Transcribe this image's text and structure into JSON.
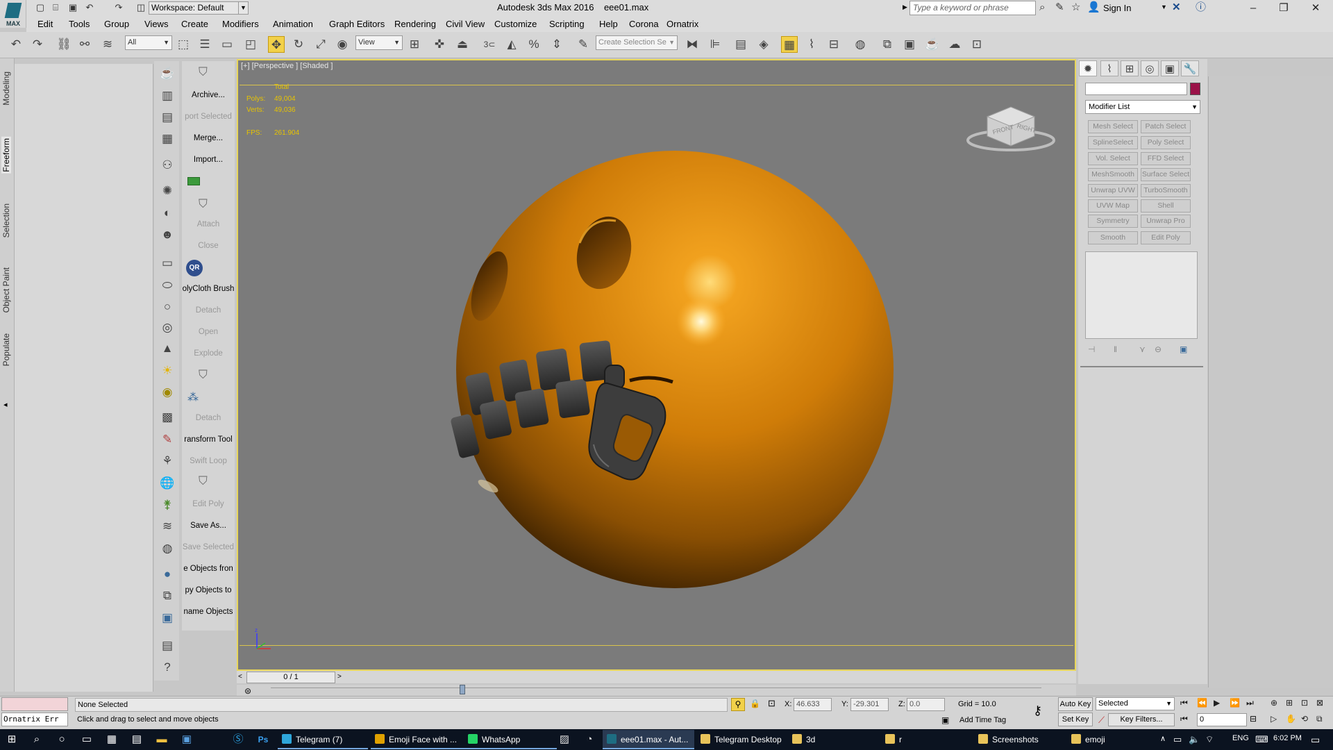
{
  "titlebar": {
    "workspace": "Workspace: Default",
    "app_title": "Autodesk 3ds Max 2016",
    "file_name": "eee01.max",
    "search_placeholder": "Type a keyword or phrase",
    "sign_in": "Sign In",
    "logo_text": "MAX"
  },
  "menu": [
    "Edit",
    "Tools",
    "Group",
    "Views",
    "Create",
    "Modifiers",
    "Animation",
    "Graph Editors",
    "Rendering",
    "Civil View",
    "Customize",
    "Scripting",
    "Help",
    "Corona",
    "Ornatrix"
  ],
  "toolbar": {
    "filter": "All",
    "ref_coord": "View",
    "selection_set_placeholder": "Create Selection Se",
    "snap_label": "3"
  },
  "ribbon_tabs": [
    "Modeling",
    "Freeform",
    "Selection",
    "Object Paint",
    "Populate"
  ],
  "command_panel": [
    {
      "label": "Archive...",
      "enabled": true
    },
    {
      "label": "port Selected",
      "enabled": false
    },
    {
      "label": "Merge...",
      "enabled": true
    },
    {
      "label": "Import...",
      "enabled": true
    },
    {
      "label": "Attach",
      "enabled": false
    },
    {
      "label": "Close",
      "enabled": false
    },
    {
      "label": "olyCloth Brush",
      "enabled": true
    },
    {
      "label": "Detach",
      "enabled": false
    },
    {
      "label": "Open",
      "enabled": false
    },
    {
      "label": "Explode",
      "enabled": false
    },
    {
      "label": "Detach",
      "enabled": false
    },
    {
      "label": "ransform Tool",
      "enabled": true
    },
    {
      "label": "Swift Loop",
      "enabled": false
    },
    {
      "label": "Edit Poly",
      "enabled": false
    },
    {
      "label": "Save As...",
      "enabled": true
    },
    {
      "label": "Save Selected",
      "enabled": false
    },
    {
      "label": "e Objects fron",
      "enabled": true
    },
    {
      "label": "py Objects to",
      "enabled": true
    },
    {
      "label": "name Objects",
      "enabled": true
    }
  ],
  "qr_badge": "QR",
  "viewport": {
    "label": "[+] [Perspective ] [Shaded ]",
    "stats": {
      "total_label": "Total",
      "polys_label": "Polys:",
      "polys": "49,004",
      "verts_label": "Verts:",
      "verts": "49,036",
      "fps_label": "FPS:",
      "fps": "261.904"
    },
    "viewcube": {
      "front": "FRONT",
      "right": "RIGHT"
    },
    "axis_z": "z"
  },
  "time_slider": {
    "frame": "0 / 1"
  },
  "modifier_panel": {
    "modifier_list": "Modifier List",
    "object_color": "#9a1248",
    "buttons": [
      "Mesh Select",
      "Patch Select",
      "SplineSelect",
      "Poly Select",
      "Vol. Select",
      "FFD Select",
      "MeshSmooth",
      "Surface Select",
      "Unwrap UVW",
      "TurboSmooth",
      "UVW Map",
      "Shell",
      "Symmetry",
      "Unwrap Pro",
      "Smooth",
      "Edit Poly"
    ]
  },
  "status": {
    "script_error": "Ornatrix Err",
    "selection": "None Selected",
    "prompt": "Click and drag to select and move objects",
    "x_label": "X:",
    "x": "46.633",
    "y_label": "Y:",
    "y": "-29.301",
    "z_label": "Z:",
    "z": "0.0",
    "grid": "Grid = 10.0",
    "add_time_tag": "Add Time Tag",
    "auto_key": "Auto Key",
    "set_key": "Set Key",
    "key_mode": "Selected",
    "key_filters": "Key Filters...",
    "frame": "0"
  },
  "taskbar": {
    "apps": [
      {
        "label": "Telegram (7)",
        "color": "#2ea6da",
        "state": "open"
      },
      {
        "label": "Emoji Face with ...",
        "color": "#e0a100",
        "state": "open"
      },
      {
        "label": "WhatsApp",
        "color": "#25d366",
        "state": "open"
      },
      {
        "label": "eee01.max - Aut...",
        "color": "#1e6d82",
        "state": "active"
      },
      {
        "label": "Telegram Desktop",
        "color": "#e8c35a",
        "state": "none"
      },
      {
        "label": "3d",
        "color": "#e8c35a",
        "state": "none"
      },
      {
        "label": "r",
        "color": "#e8c35a",
        "state": "none"
      },
      {
        "label": "Screenshots",
        "color": "#e8c35a",
        "state": "none"
      },
      {
        "label": "emoji",
        "color": "#e8c35a",
        "state": "none"
      }
    ],
    "language": "ENG",
    "time": "6:02 PM"
  },
  "colors": {
    "viewport_bg": "#7b7b7b",
    "active_border": "#e8d65a",
    "sphere": "#d4820a",
    "zipper": "#3a3a3a"
  }
}
